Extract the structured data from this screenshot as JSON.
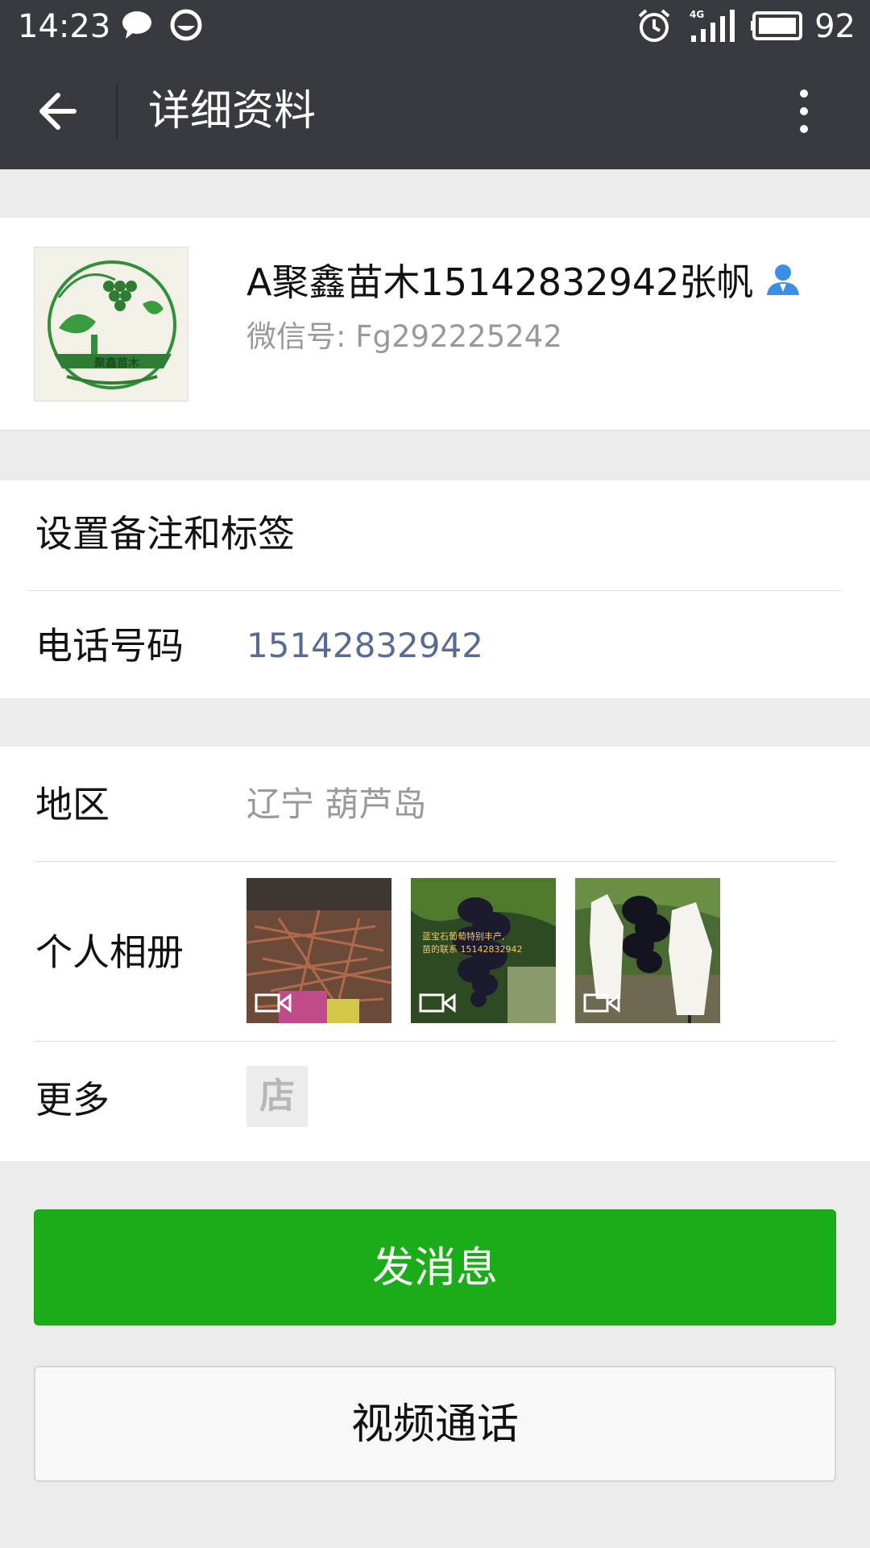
{
  "status_bar": {
    "time": "14:23",
    "battery": "92",
    "network": "4G",
    "icons": [
      "chat-bubble-icon",
      "notification-icon",
      "alarm-icon",
      "signal-icon",
      "battery-icon"
    ]
  },
  "nav": {
    "title": "详细资料",
    "icons": [
      "back-arrow-icon",
      "more-vertical-icon"
    ]
  },
  "profile": {
    "name": "A聚鑫苗木15142832942张帆",
    "wechat_id": "微信号: Fg292225242",
    "avatar_text": "聚鑫苗木"
  },
  "remark_row": {
    "label": "设置备注和标签"
  },
  "phone_row": {
    "label": "电话号码",
    "value": "15142832942"
  },
  "region_row": {
    "label": "地区",
    "value": "辽宁  葫芦岛"
  },
  "album_row": {
    "label": "个人相册",
    "photos": [
      {
        "caption": ""
      },
      {
        "caption": "蓝宝石葡萄特别丰产，苗的联系 15142832942"
      },
      {
        "caption": ""
      }
    ]
  },
  "more_row": {
    "label": "更多",
    "store_label": "店"
  },
  "buttons": {
    "send_message": "发消息",
    "video_call": "视频通话"
  },
  "colors": {
    "header_bg": "#393a3f",
    "primary_green": "#1aad19",
    "link_blue": "#576b95",
    "page_bg": "#ebebeb"
  }
}
